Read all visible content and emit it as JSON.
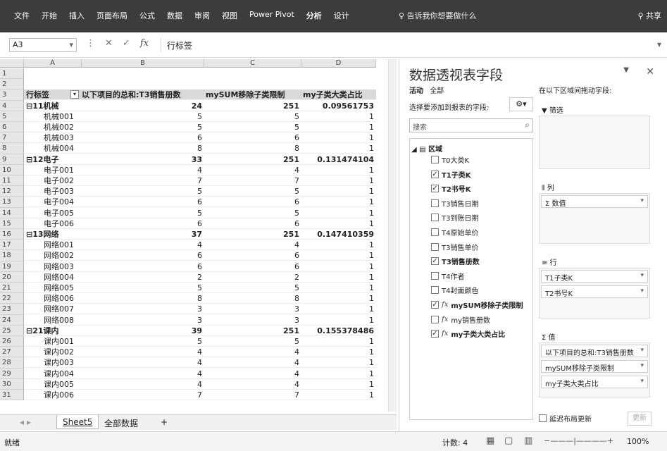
{
  "ribbon": {
    "menu": [
      "文件",
      "开始",
      "插入",
      "页面布局",
      "公式",
      "数据",
      "审阅",
      "视图",
      "Power Pivot",
      "分析",
      "设计"
    ],
    "tell_me": "告诉我你想要做什么",
    "share": "共享"
  },
  "formula_bar": {
    "name_box": "A3",
    "formula": "行标签"
  },
  "grid": {
    "columns": [
      "A",
      "B",
      "C",
      "D"
    ],
    "header_row": [
      "行标签",
      "以下项目的总和:T3销售册数",
      "mySUM移除子类限制",
      "my子类大类占比"
    ],
    "rows": [
      {
        "n": "1",
        "a": "",
        "b": "",
        "c": "",
        "d": "",
        "bold": false
      },
      {
        "n": "2",
        "a": "",
        "b": "",
        "c": "",
        "d": "",
        "bold": false
      },
      {
        "n": "4",
        "a": "⊟11机械",
        "b": "24",
        "c": "251",
        "d": "0.09561753",
        "bold": true
      },
      {
        "n": "5",
        "a": "机械001",
        "b": "5",
        "c": "5",
        "d": "1",
        "bold": false
      },
      {
        "n": "6",
        "a": "机械002",
        "b": "5",
        "c": "5",
        "d": "1",
        "bold": false
      },
      {
        "n": "7",
        "a": "机械003",
        "b": "6",
        "c": "6",
        "d": "1",
        "bold": false
      },
      {
        "n": "8",
        "a": "机械004",
        "b": "8",
        "c": "8",
        "d": "1",
        "bold": false
      },
      {
        "n": "9",
        "a": "⊟12电子",
        "b": "33",
        "c": "251",
        "d": "0.131474104",
        "bold": true
      },
      {
        "n": "10",
        "a": "电子001",
        "b": "4",
        "c": "4",
        "d": "1",
        "bold": false
      },
      {
        "n": "11",
        "a": "电子002",
        "b": "7",
        "c": "7",
        "d": "1",
        "bold": false
      },
      {
        "n": "12",
        "a": "电子003",
        "b": "5",
        "c": "5",
        "d": "1",
        "bold": false
      },
      {
        "n": "13",
        "a": "电子004",
        "b": "6",
        "c": "6",
        "d": "1",
        "bold": false
      },
      {
        "n": "14",
        "a": "电子005",
        "b": "5",
        "c": "5",
        "d": "1",
        "bold": false
      },
      {
        "n": "15",
        "a": "电子006",
        "b": "6",
        "c": "6",
        "d": "1",
        "bold": false
      },
      {
        "n": "16",
        "a": "⊟13网络",
        "b": "37",
        "c": "251",
        "d": "0.147410359",
        "bold": true
      },
      {
        "n": "17",
        "a": "网络001",
        "b": "4",
        "c": "4",
        "d": "1",
        "bold": false
      },
      {
        "n": "18",
        "a": "网络002",
        "b": "6",
        "c": "6",
        "d": "1",
        "bold": false
      },
      {
        "n": "19",
        "a": "网络003",
        "b": "6",
        "c": "6",
        "d": "1",
        "bold": false
      },
      {
        "n": "20",
        "a": "网络004",
        "b": "2",
        "c": "2",
        "d": "1",
        "bold": false
      },
      {
        "n": "21",
        "a": "网络005",
        "b": "5",
        "c": "5",
        "d": "1",
        "bold": false
      },
      {
        "n": "22",
        "a": "网络006",
        "b": "8",
        "c": "8",
        "d": "1",
        "bold": false
      },
      {
        "n": "23",
        "a": "网络007",
        "b": "3",
        "c": "3",
        "d": "1",
        "bold": false
      },
      {
        "n": "24",
        "a": "网络008",
        "b": "3",
        "c": "3",
        "d": "1",
        "bold": false
      },
      {
        "n": "25",
        "a": "⊟21课内",
        "b": "39",
        "c": "251",
        "d": "0.155378486",
        "bold": true
      },
      {
        "n": "26",
        "a": "课内001",
        "b": "5",
        "c": "5",
        "d": "1",
        "bold": false
      },
      {
        "n": "27",
        "a": "课内002",
        "b": "4",
        "c": "4",
        "d": "1",
        "bold": false
      },
      {
        "n": "28",
        "a": "课内003",
        "b": "4",
        "c": "4",
        "d": "1",
        "bold": false
      },
      {
        "n": "29",
        "a": "课内004",
        "b": "4",
        "c": "4",
        "d": "1",
        "bold": false
      },
      {
        "n": "30",
        "a": "课内005",
        "b": "4",
        "c": "4",
        "d": "1",
        "bold": false
      },
      {
        "n": "31",
        "a": "课内006",
        "b": "7",
        "c": "7",
        "d": "1",
        "bold": false
      }
    ]
  },
  "sheets": {
    "tabs": [
      "Sheet5",
      "全部数据"
    ],
    "active": "Sheet5",
    "add": "+"
  },
  "status": {
    "ready": "就绪",
    "count": "计数: 4",
    "zoom": "100%"
  },
  "pivot_pane": {
    "title": "数据透视表字段",
    "tabs": [
      "活动",
      "全部"
    ],
    "choose_label": "选择要添加到报表的字段:",
    "drag_label": "在以下区域间拖动字段:",
    "search_placeholder": "搜索",
    "area_root": "区域",
    "fields": [
      {
        "label": "T0大类K",
        "checked": false,
        "fx": false,
        "bold": false
      },
      {
        "label": "T1子类K",
        "checked": true,
        "fx": false,
        "bold": true
      },
      {
        "label": "T2书号K",
        "checked": true,
        "fx": false,
        "bold": true
      },
      {
        "label": "T3销售日期",
        "checked": false,
        "fx": false,
        "bold": false
      },
      {
        "label": "T3到账日期",
        "checked": false,
        "fx": false,
        "bold": false
      },
      {
        "label": "T4原始单价",
        "checked": false,
        "fx": false,
        "bold": false
      },
      {
        "label": "T3销售单价",
        "checked": false,
        "fx": false,
        "bold": false
      },
      {
        "label": "T3销售册数",
        "checked": true,
        "fx": false,
        "bold": true
      },
      {
        "label": "T4作者",
        "checked": false,
        "fx": false,
        "bold": false
      },
      {
        "label": "T4封面颜色",
        "checked": false,
        "fx": false,
        "bold": false
      },
      {
        "label": "mySUM移除子类限制",
        "checked": true,
        "fx": true,
        "bold": true
      },
      {
        "label": "my销售册数",
        "checked": false,
        "fx": true,
        "bold": false
      },
      {
        "label": "my子类大类占比",
        "checked": true,
        "fx": true,
        "bold": true
      }
    ],
    "filters_label": "筛选",
    "columns_label": "列",
    "columns_items": [
      "Σ 数值"
    ],
    "rows_label": "行",
    "rows_items": [
      "T1子类K",
      "T2书号K"
    ],
    "values_label": "Σ 值",
    "values_items": [
      "以下项目的总和:T3销售册数",
      "mySUM移除子类限制",
      "my子类大类占比"
    ],
    "defer_label": "延迟布局更新",
    "update_label": "更新"
  }
}
